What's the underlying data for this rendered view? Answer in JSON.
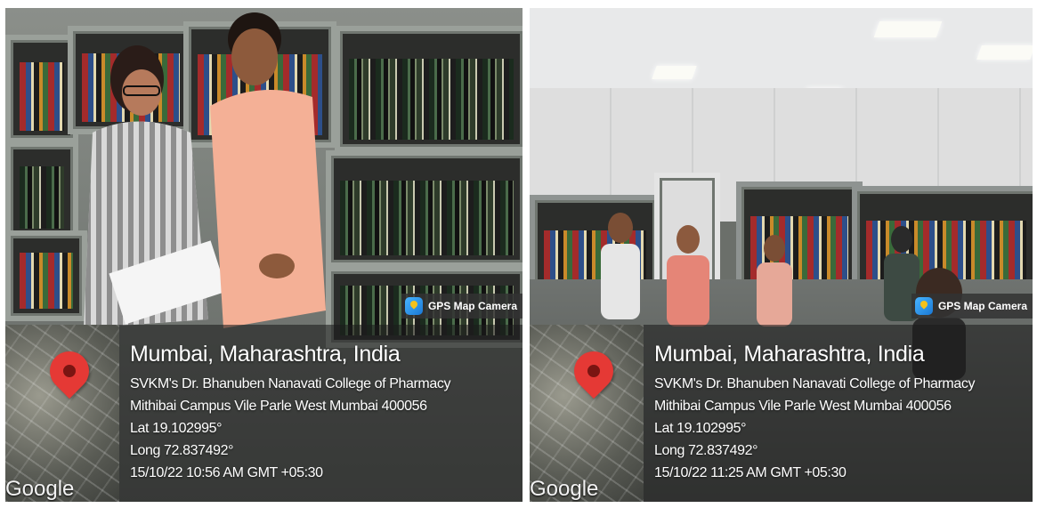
{
  "photos": [
    {
      "gps_badge": "GPS Map Camera",
      "location": "Mumbai, Maharashtra, India",
      "address_line1": "SVKM's Dr. Bhanuben Nanavati College of Pharmacy",
      "address_line2": "Mithibai Campus Vile Parle West Mumbai 400056",
      "lat": "Lat 19.102995°",
      "long": "Long 72.837492°",
      "datetime": "15/10/22 10:56 AM GMT +05:30",
      "map_logo": "Google",
      "pin_icon": "map-pin-icon"
    },
    {
      "gps_badge": "GPS Map Camera",
      "location": "Mumbai, Maharashtra, India",
      "address_line1": "SVKM's Dr. Bhanuben Nanavati College of Pharmacy",
      "address_line2": "Mithibai Campus Vile Parle West Mumbai 400056",
      "lat": "Lat 19.102995°",
      "long": "Long 72.837492°",
      "datetime": "15/10/22 11:25 AM GMT +05:30",
      "map_logo": "Google",
      "pin_icon": "map-pin-icon"
    }
  ],
  "colors": {
    "pin": "#e53935",
    "gps_icon": "#1a78d4",
    "overlay_text": "#ffffff"
  }
}
